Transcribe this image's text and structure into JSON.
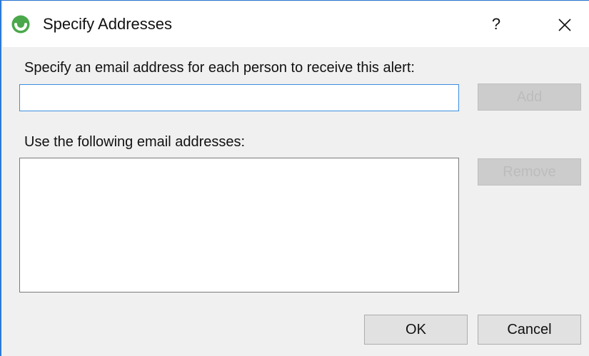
{
  "window": {
    "title": "Specify Addresses",
    "help_label": "?",
    "app_icon": "green-circle-logo-icon",
    "close_icon": "close-icon"
  },
  "form": {
    "email_prompt": "Specify an email address for each person to receive this alert:",
    "email_value": "",
    "add_label": "Add",
    "list_label": "Use the following email addresses:",
    "remove_label": "Remove",
    "addresses": []
  },
  "footer": {
    "ok_label": "OK",
    "cancel_label": "Cancel"
  },
  "colors": {
    "accent": "#2b79d8",
    "input_focus_border": "#3b8ee0",
    "icon_green": "#4aa84a"
  }
}
